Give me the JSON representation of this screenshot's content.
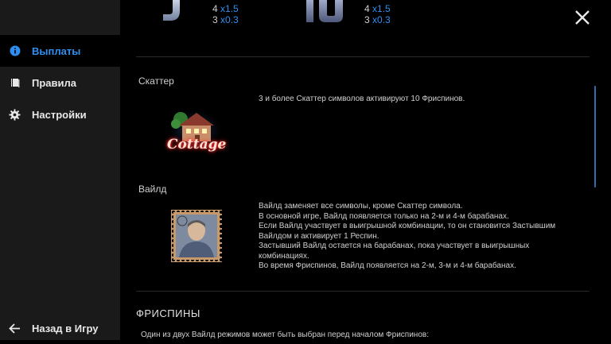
{
  "sidebar": {
    "items": [
      {
        "label": "Выплаты",
        "icon": "info-icon",
        "active": true
      },
      {
        "label": "Правила",
        "icon": "book-icon",
        "active": false
      },
      {
        "label": "Настройки",
        "icon": "gear-icon",
        "active": false
      }
    ],
    "back_label": "Назад в Игру",
    "back_icon": "arrow-left-icon"
  },
  "paytable_top": [
    {
      "symbol_icon": "j-symbol-icon",
      "lines": [
        {
          "count": "4",
          "mult": "x1.5"
        },
        {
          "count": "3",
          "mult": "x0.3"
        }
      ]
    },
    {
      "symbol_icon": "10-symbol-icon",
      "lines": [
        {
          "count": "4",
          "mult": "x1.5"
        },
        {
          "count": "3",
          "mult": "x0.3"
        }
      ]
    }
  ],
  "scatter": {
    "heading": "Скаттер",
    "logo_text": "Cottage",
    "description": "3 и более Скаттер символов активируют 10 Фриспинов."
  },
  "wild": {
    "heading": "Вайлд",
    "description_lines": [
      "Вайлд заменяет все символы, кроме Скаттер символа.",
      "В основной игре, Вайлд появляется только на 2-м и 4-м барабанах.",
      "Если Вайлд участвует в выигрышной комбинации, то он становится Застывшим",
      "Вайлдом и активирует 1 Респин.",
      "Застывший Вайлд остается на барабанах, пока участвует в выигрышных",
      "комбинациях.",
      "Во время Фриспинов, Вайлд появляется на 2-м, 3-м и 4-м барабанах."
    ]
  },
  "freespins": {
    "title": "ФРИСПИНЫ",
    "intro": "Один из двух Вайлд режимов может быть выбран перед началом Фриспинов:"
  },
  "colors": {
    "accent": "#2f8ff0",
    "sidebar_bg": "#1a1a1a",
    "main_bg": "#000000"
  }
}
